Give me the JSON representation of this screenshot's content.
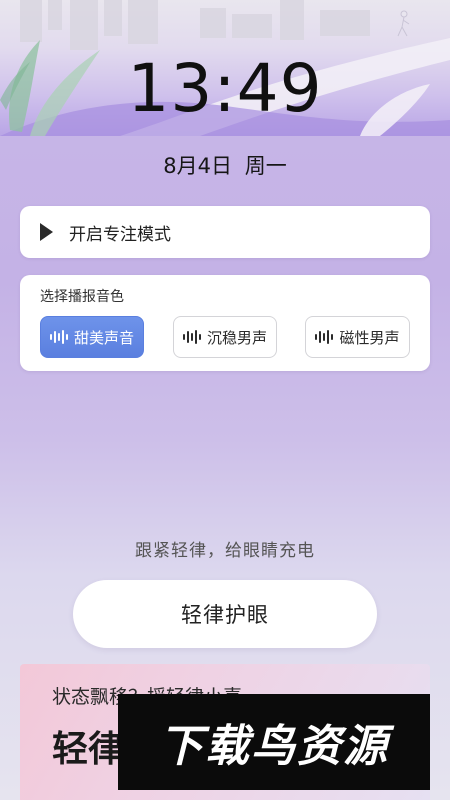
{
  "clock": {
    "time": "13:49"
  },
  "date": {
    "day": "8月4日",
    "weekday": "周一"
  },
  "focus_mode": {
    "label": "开启专注模式",
    "icon": "play-icon"
  },
  "voice": {
    "title": "选择播报音色",
    "options": [
      {
        "label": "甜美声音",
        "selected": true
      },
      {
        "label": "沉稳男声",
        "selected": false
      },
      {
        "label": "磁性男声",
        "selected": false
      }
    ],
    "accent": "#5a7fdf"
  },
  "tagline": "跟紧轻律，给眼睛充电",
  "main_button": {
    "label": "轻律护眼"
  },
  "promo": {
    "question": "状态飘移？摇轻律小喜",
    "headline": "轻律"
  },
  "watermark": {
    "text": "下载鸟资源"
  }
}
